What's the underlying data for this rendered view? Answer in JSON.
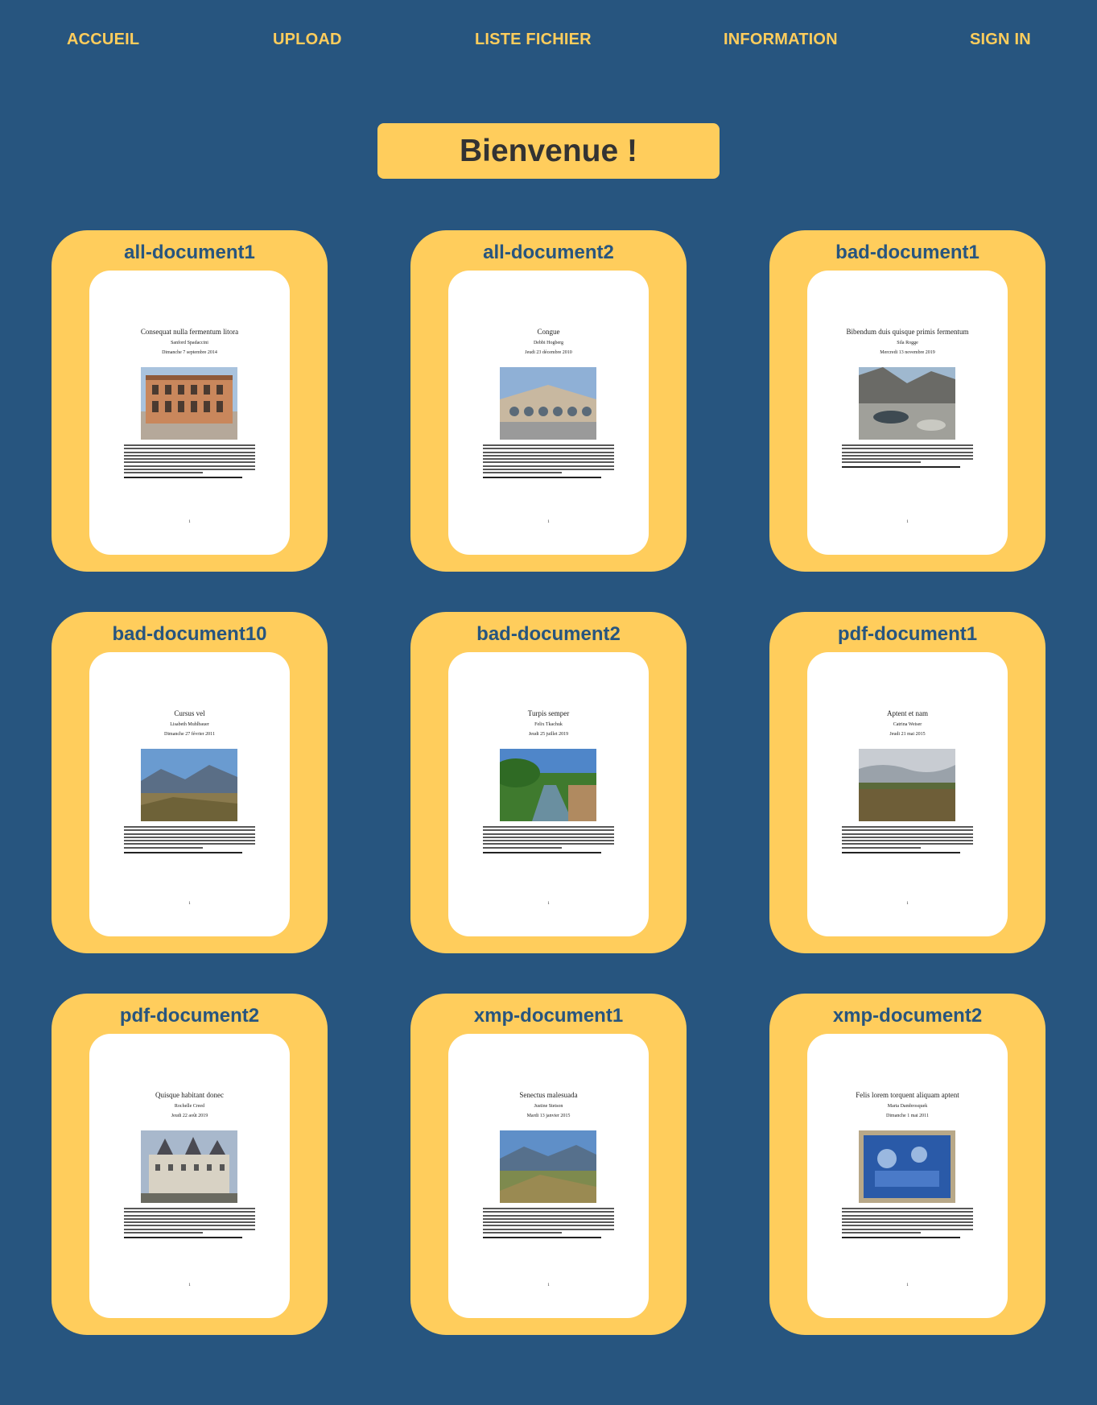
{
  "nav": {
    "items": [
      {
        "label": "ACCUEIL"
      },
      {
        "label": "UPLOAD"
      },
      {
        "label": "LISTE FICHIER"
      },
      {
        "label": "INFORMATION"
      },
      {
        "label": "SIGN IN"
      }
    ]
  },
  "welcome": {
    "text": "Bienvenue !"
  },
  "colors": {
    "background": "#27557f",
    "accent": "#ffcd5c",
    "card_title": "#27557f"
  },
  "documents": [
    {
      "name": "all-document1",
      "title": "Consequat nulla fermentum litora",
      "author": "Sanford Spadaccini",
      "date": "Dimanche 7 septembre 2014",
      "image": "building-photo",
      "page": "1"
    },
    {
      "name": "all-document2",
      "title": "Congue",
      "author": "Debbi Hogberg",
      "date": "Jeudi 23 décembre 2010",
      "image": "station-photo",
      "page": "1"
    },
    {
      "name": "bad-document1",
      "title": "Bibendum duis quisque primis fermentum",
      "author": "Sila Rogge",
      "date": "Mercredi 13 novembre 2019",
      "image": "river-rocks-photo",
      "page": "1"
    },
    {
      "name": "bad-document10",
      "title": "Cursus vel",
      "author": "Lisabeth Muhlbauer",
      "date": "Dimanche 27 février 2011",
      "image": "mountain-photo",
      "page": "1"
    },
    {
      "name": "bad-document2",
      "title": "Turpis semper",
      "author": "Felix Tkachuk",
      "date": "Jeudi 25 juillet 2019",
      "image": "stream-photo",
      "page": "1"
    },
    {
      "name": "pdf-document1",
      "title": "Aptent et nam",
      "author": "Catrina Weiser",
      "date": "Jeudi 21 mai 2015",
      "image": "field-photo",
      "page": "1"
    },
    {
      "name": "pdf-document2",
      "title": "Quisque habitant donec",
      "author": "Rochelle Creed",
      "date": "Jeudi 22 août 2019",
      "image": "castle-photo",
      "page": "1"
    },
    {
      "name": "xmp-document1",
      "title": "Senectus malesuada",
      "author": "Justine Stetson",
      "date": "Mardi 13 janvier 2015",
      "image": "valley-photo",
      "page": "1"
    },
    {
      "name": "xmp-document2",
      "title": "Felis lorem torquent aliquam aptent",
      "author": "Marta Dambrosquek",
      "date": "Dimanche 1 mai 2011",
      "image": "mural-photo",
      "page": "1"
    }
  ]
}
